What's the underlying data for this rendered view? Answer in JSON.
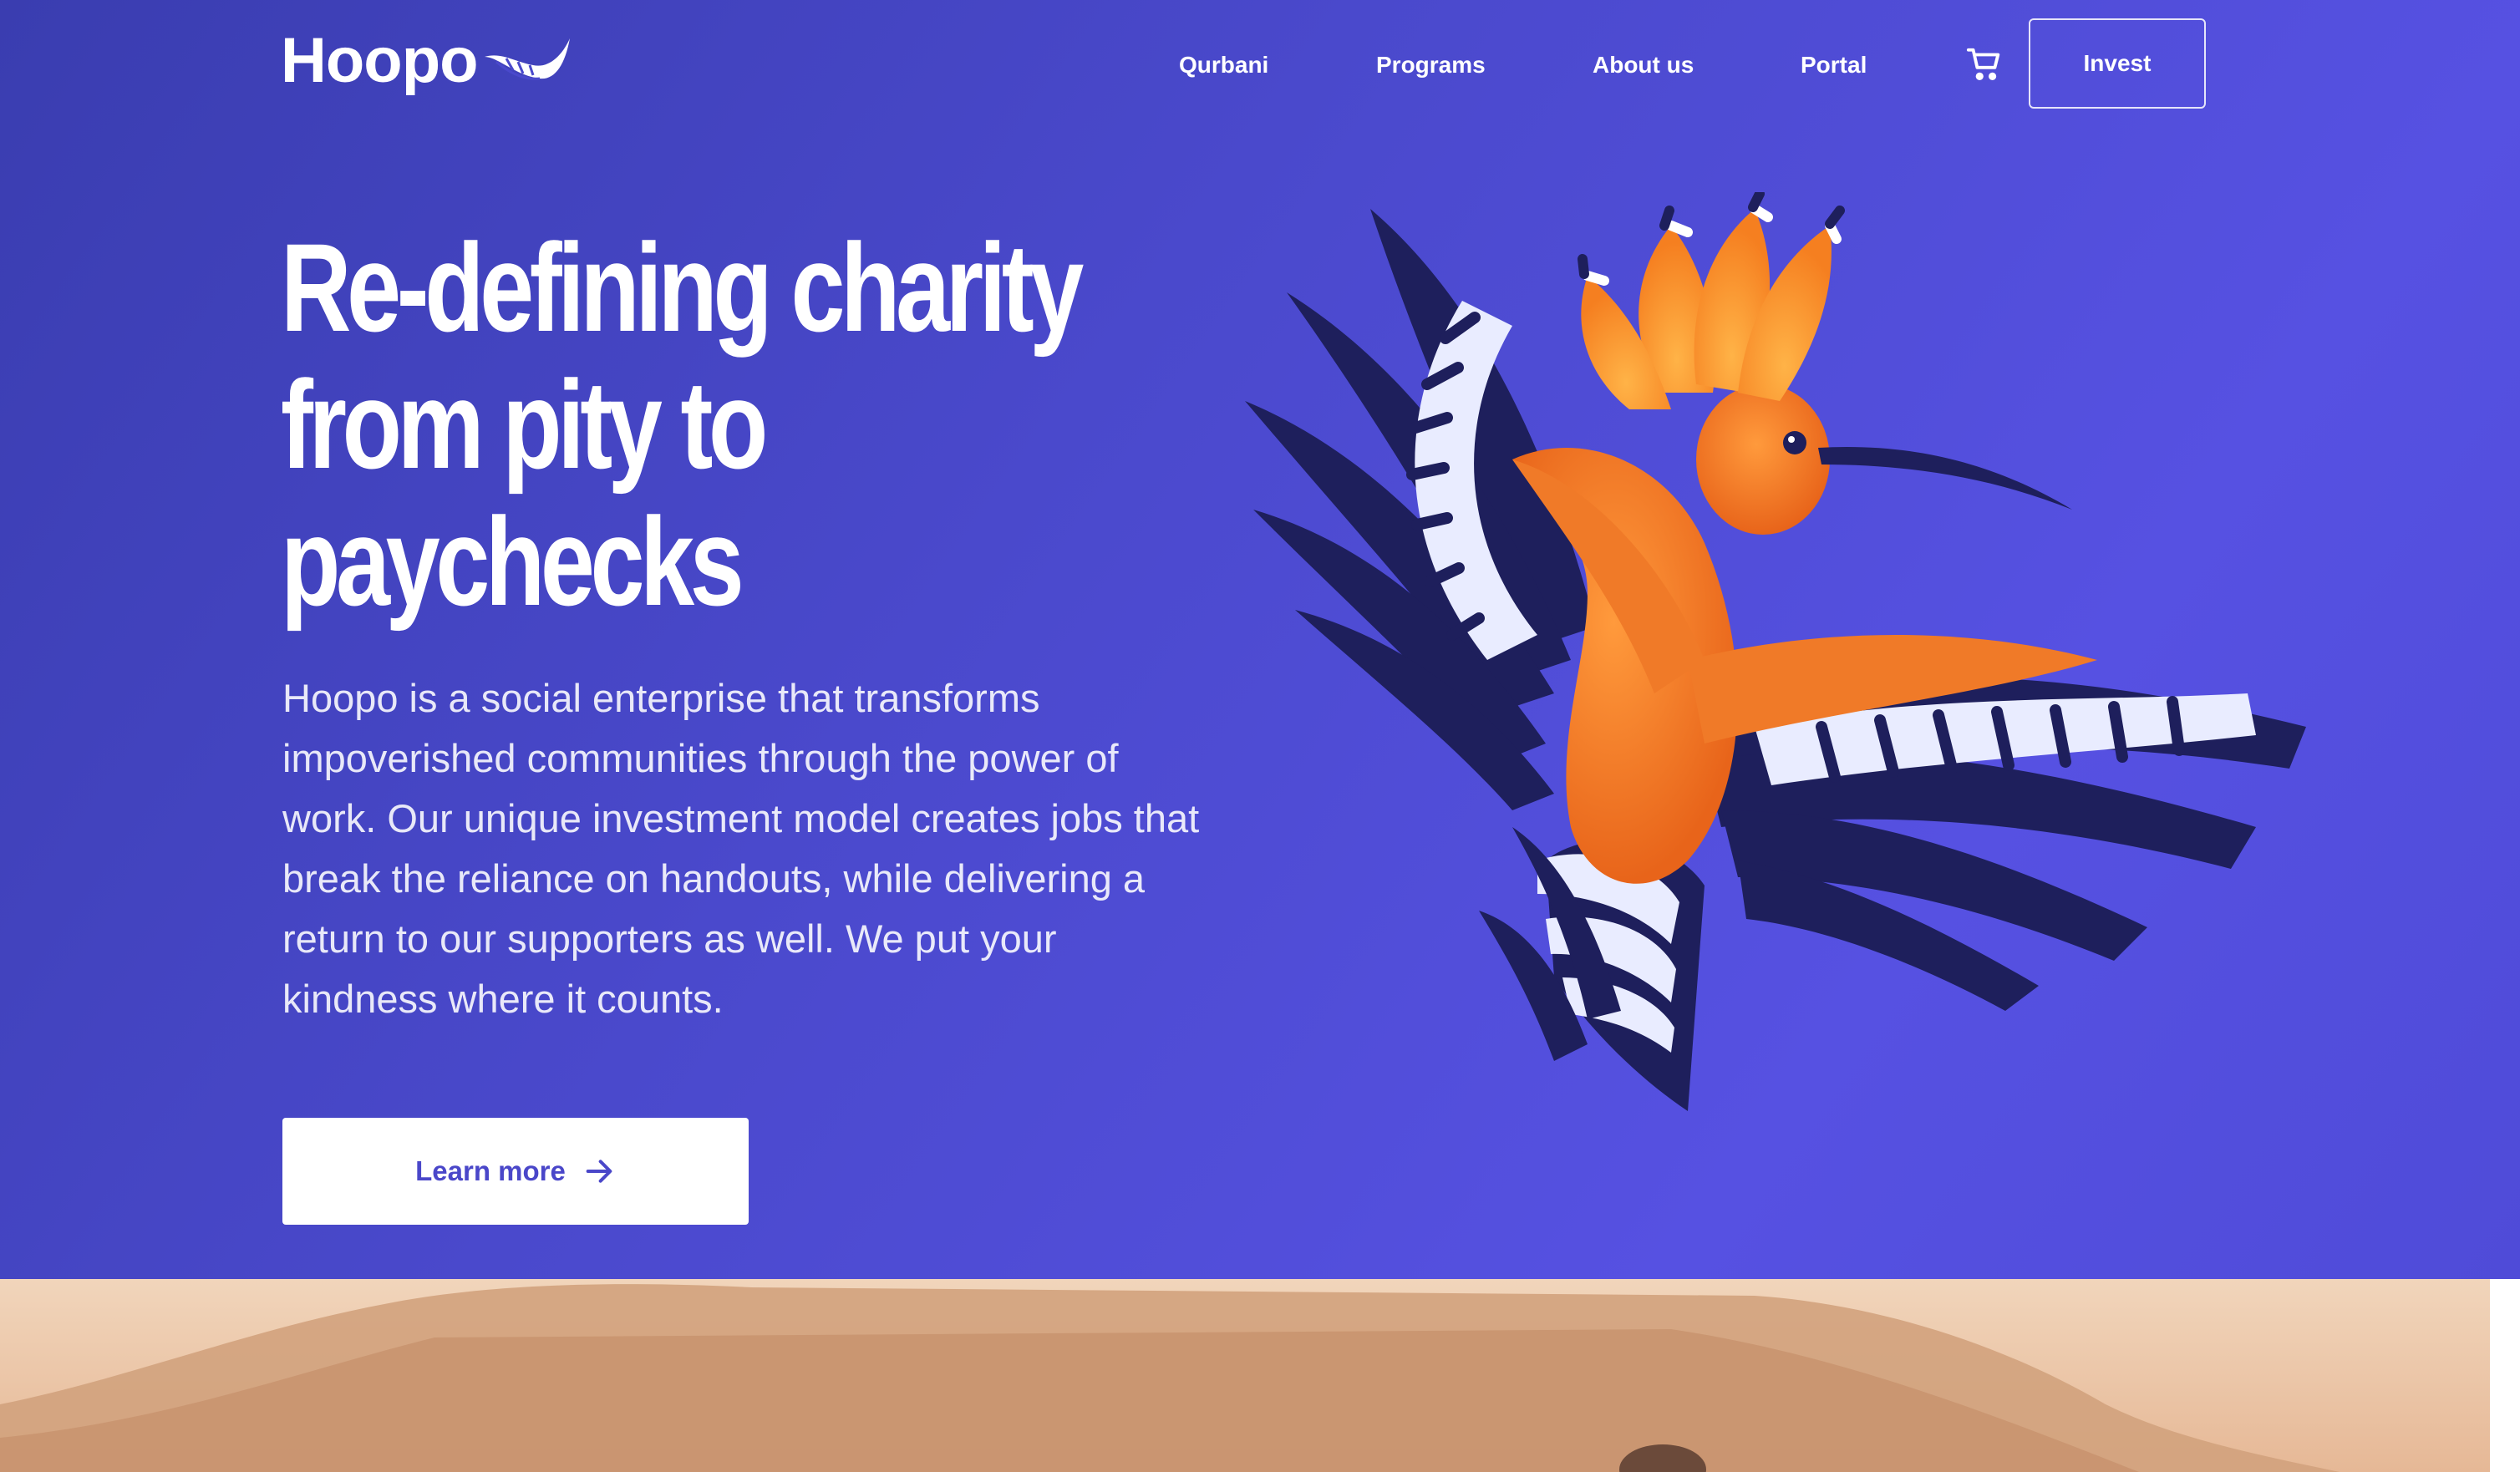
{
  "brand": {
    "name": "Hoopo",
    "logo_icon": "feather-icon"
  },
  "nav": {
    "links": [
      "Qurbani",
      "Programs",
      "About us",
      "Portal"
    ],
    "cart_icon": "cart-icon",
    "invest_label": "Invest"
  },
  "hero": {
    "headline_lines": [
      "Re-defining charity",
      "from pity to",
      "paychecks"
    ],
    "body": "Hoopo is a social enterprise that transforms impoverished communities through the power of work. Our unique investment model creates jobs that break the reliance on handouts, while delivering a return to our supporters as well. We put your kindness where it counts.",
    "cta_label": "Learn more",
    "cta_icon": "arrow-right-icon",
    "illustration": "hoopoe-bird-illustration"
  },
  "colors": {
    "hero_bg": "#4a49cc",
    "cta_text": "#4a47c9",
    "bird_orange": "#f07a28",
    "wing_dark": "#1e1f5c"
  }
}
